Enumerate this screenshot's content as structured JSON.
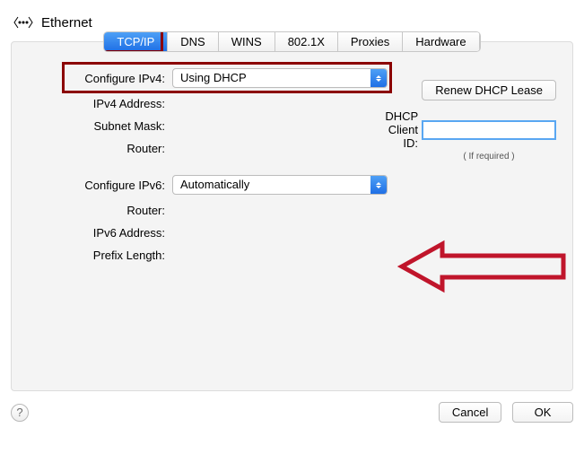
{
  "header": {
    "title": "Ethernet"
  },
  "tabs": {
    "tcpip": "TCP/IP",
    "dns": "DNS",
    "wins": "WINS",
    "dot1x": "802.1X",
    "proxies": "Proxies",
    "hardware": "Hardware"
  },
  "labels": {
    "configure_ipv4": "Configure IPv4:",
    "ipv4_address": "IPv4 Address:",
    "subnet_mask": "Subnet Mask:",
    "router": "Router:",
    "configure_ipv6": "Configure IPv6:",
    "router6": "Router:",
    "ipv6_address": "IPv6 Address:",
    "prefix_length": "Prefix Length:"
  },
  "selects": {
    "ipv4": "Using DHCP",
    "ipv6": "Automatically"
  },
  "right": {
    "renew": "Renew DHCP Lease",
    "client_id_label": "DHCP Client ID:",
    "client_id_value": "",
    "hint": "( If required )"
  },
  "footer": {
    "help": "?",
    "cancel": "Cancel",
    "ok": "OK"
  }
}
